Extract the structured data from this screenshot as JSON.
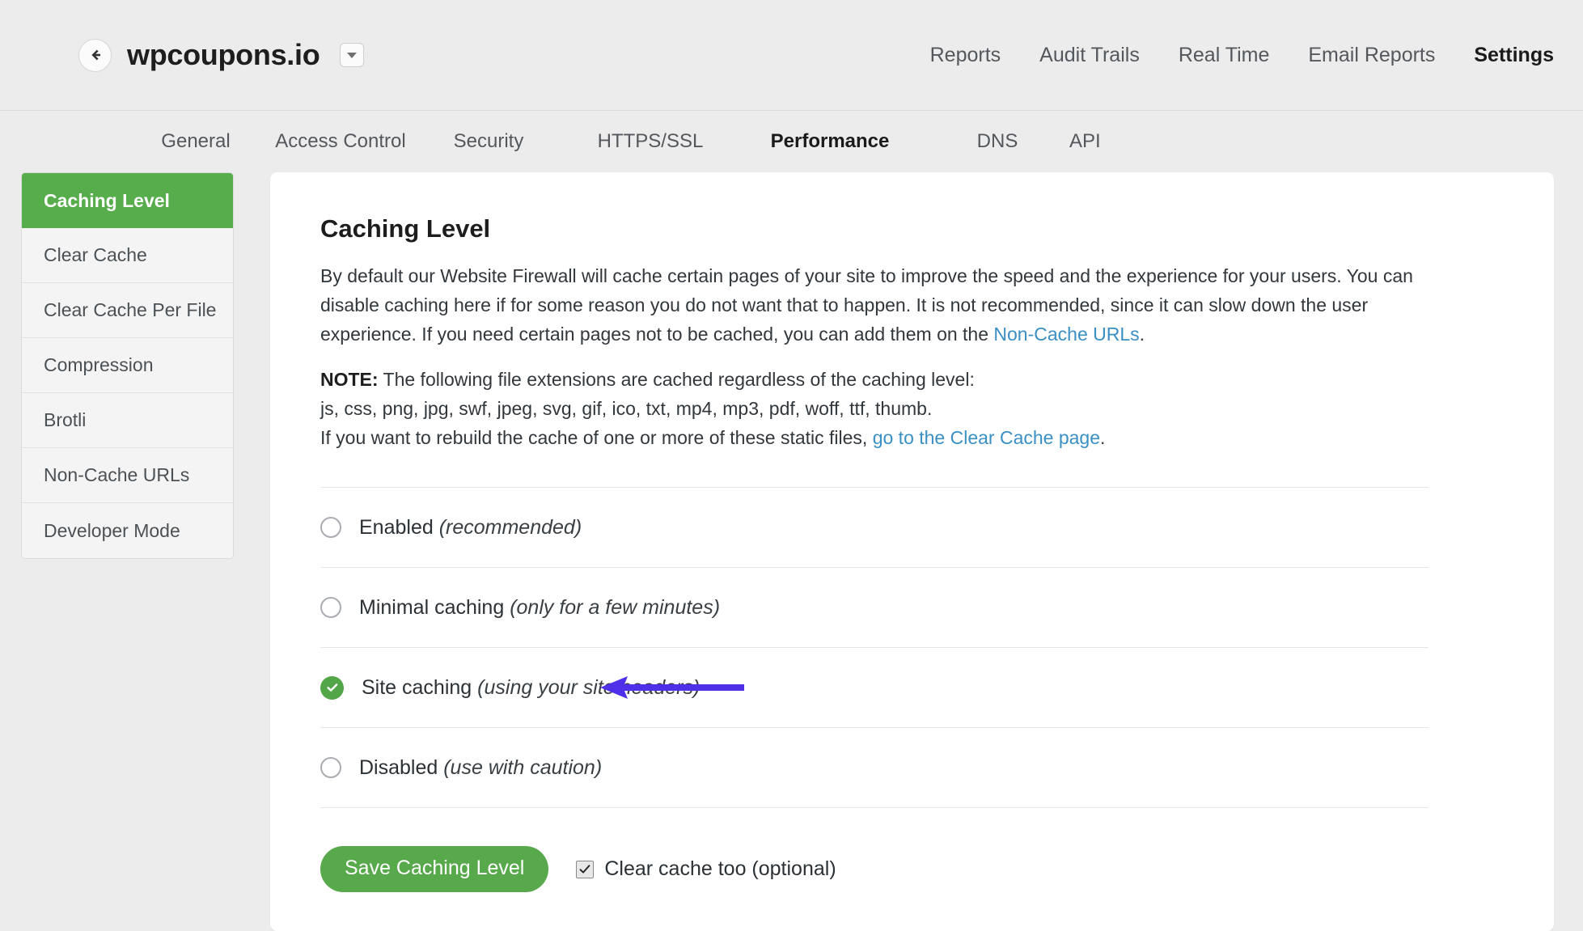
{
  "header": {
    "back_icon": "arrow-left-icon",
    "site_title": "wpcoupons.io",
    "dropdown_icon": "chevron-down-icon",
    "nav": [
      {
        "label": "Reports",
        "active": false
      },
      {
        "label": "Audit Trails",
        "active": false
      },
      {
        "label": "Real Time",
        "active": false
      },
      {
        "label": "Email Reports",
        "active": false
      },
      {
        "label": "Settings",
        "active": true
      }
    ]
  },
  "subtabs": [
    {
      "label": "General",
      "active": false
    },
    {
      "label": "Access Control",
      "active": false
    },
    {
      "label": "Security",
      "active": false
    },
    {
      "label": "HTTPS/SSL",
      "active": false
    },
    {
      "label": "Performance",
      "active": true
    },
    {
      "label": "DNS",
      "active": false
    },
    {
      "label": "API",
      "active": false
    }
  ],
  "sidemenu": [
    {
      "label": "Caching Level",
      "active": true
    },
    {
      "label": "Clear Cache",
      "active": false
    },
    {
      "label": "Clear Cache Per File",
      "active": false
    },
    {
      "label": "Compression",
      "active": false
    },
    {
      "label": "Brotli",
      "active": false
    },
    {
      "label": "Non-Cache URLs",
      "active": false
    },
    {
      "label": "Developer Mode",
      "active": false
    }
  ],
  "main": {
    "title": "Caching Level",
    "paragraph_part1": "By default our Website Firewall will cache certain pages of your site to improve the speed and the experience for your users. You can disable caching here if for some reason you do not want that to happen. It is not recommended, since it can slow down the user experience. If you need certain pages not to be cached, you can add them on the ",
    "paragraph_link": "Non-Cache URLs",
    "paragraph_part2": ".",
    "note_label": "NOTE:",
    "note_text": " The following file extensions are cached regardless of the caching level:",
    "note_extensions": "js, css, png, jpg, swf, jpeg, svg, gif, ico, txt, mp4, mp3, pdf, woff, ttf, thumb.",
    "note_rebuild_part1": "If you want to rebuild the cache of one or more of these static files, ",
    "note_rebuild_link": "go to the Clear Cache page",
    "note_rebuild_part2": "."
  },
  "options": [
    {
      "label": "Enabled",
      "hint": "(recommended)",
      "selected": false
    },
    {
      "label": "Minimal caching",
      "hint": "(only for a few minutes)",
      "selected": false
    },
    {
      "label": "Site caching",
      "hint": "(using your site headers)",
      "selected": true
    },
    {
      "label": "Disabled",
      "hint": "(use with caution)",
      "selected": false
    }
  ],
  "actions": {
    "save_label": "Save Caching Level",
    "clear_cache_label": "Clear cache too (optional)",
    "clear_cache_checked": true
  },
  "annotation": {
    "type": "arrow-left",
    "points_to": "Site caching",
    "color": "#4f2fe8"
  },
  "colors": {
    "page_background": "#ececec",
    "card_background": "#ffffff",
    "accent_green": "#57ad4b",
    "button_green": "#57a94b",
    "link_blue": "#3a8fc4",
    "annotation_purple": "#4f2fe8",
    "text_primary": "#32373c"
  }
}
